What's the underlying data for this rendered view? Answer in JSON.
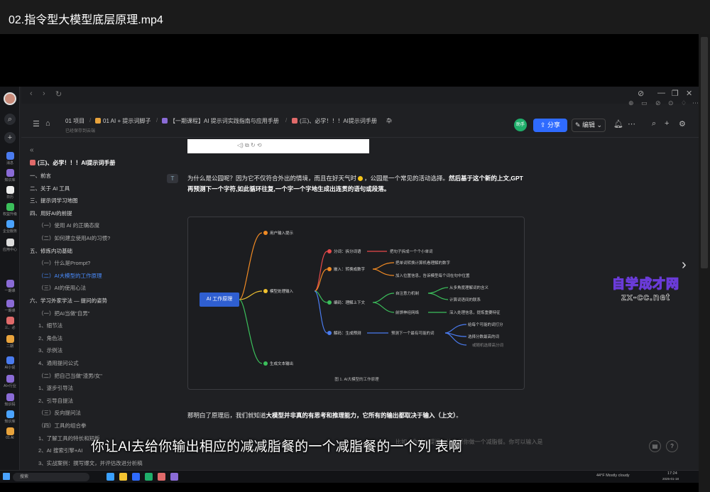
{
  "player": {
    "title": "02.指令型大模型底层原理.mp4",
    "next_icon": "chevron-right-icon"
  },
  "browser": {
    "nav": [
      "‹",
      "›",
      "↻"
    ],
    "window_controls": [
      "⊘",
      "—",
      "❐",
      "✕"
    ],
    "toolbar_icons": [
      "⊕",
      "▭",
      "⊘",
      "⊙",
      "♢",
      "⋯"
    ]
  },
  "doc_header": {
    "breadcrumbs": [
      {
        "label": "01 项目",
        "color": ""
      },
      {
        "label": "01 AI + 提示词脚子",
        "color": "#e8a33c"
      },
      {
        "label": "【一期课程】AI 提示词实践指南与应用手册",
        "color": "#8a6bd6"
      },
      {
        "label": "(三)、必学！！！AI提示词手册",
        "color": "#e06a6a"
      },
      {
        "label": "卆",
        "color": ""
      }
    ],
    "saved_note": "已经保存到云端",
    "assist_label": "助手",
    "share_label": "分享",
    "edit_label": "编辑",
    "icons": [
      "bell-icon",
      "more-icon",
      "search-icon",
      "add-icon",
      "settings-icon"
    ]
  },
  "outline": {
    "doc_title": "(三)、必学！！！AI提示词手册",
    "items": [
      {
        "label": "一、前言",
        "level": 1,
        "active": false
      },
      {
        "label": "二、关于 AI 工具",
        "level": 1,
        "active": false
      },
      {
        "label": "三、提示词学习地图",
        "level": 1,
        "active": false
      },
      {
        "label": "四、用好AI的前提",
        "level": 1,
        "active": false
      },
      {
        "label": "（一）使用 AI 的正确态度",
        "level": 2,
        "active": false
      },
      {
        "label": "（二）如何建立使用AI的习惯?",
        "level": 2,
        "active": false
      },
      {
        "label": "五、修炼内功基础",
        "level": 1,
        "active": false
      },
      {
        "label": "（一）什么是Prompt?",
        "level": 2,
        "active": false
      },
      {
        "label": "（二）AI大模型的工作原理",
        "level": 2,
        "active": true
      },
      {
        "label": "（三）AI的使用心法",
        "level": 2,
        "active": false
      },
      {
        "label": "六、学习外家学法 — 提问的姿势",
        "level": 1,
        "active": false
      },
      {
        "label": "（一）把AI当做\"自男\"",
        "level": 2,
        "active": false
      },
      {
        "label": "1、细节法",
        "level": 2,
        "active": false
      },
      {
        "label": "2、角色法",
        "level": 2,
        "active": false
      },
      {
        "label": "3、示例法",
        "level": 2,
        "active": false
      },
      {
        "label": "4、通用提问公式",
        "level": 2,
        "active": false
      },
      {
        "label": "（二）把自己当做\"渣男/女\"",
        "level": 2,
        "active": false
      },
      {
        "label": "1、逐步引导法",
        "level": 2,
        "active": false
      },
      {
        "label": "2、引导自提法",
        "level": 2,
        "active": false
      },
      {
        "label": "（三）反向提问法",
        "level": 2,
        "active": false
      },
      {
        "label": "（四）工具的组合拳",
        "level": 2,
        "active": false
      },
      {
        "label": "1、了解工具的特长和短板",
        "level": 2,
        "active": false
      },
      {
        "label": "2、AI 搜索引擎+AI",
        "level": 2,
        "active": false
      },
      {
        "label": "3、实战案例：撰写爆文，并评估改进分析稿",
        "level": 2,
        "active": false
      }
    ]
  },
  "content": {
    "para1_lead": "为什么是公园呢？因为它不仅符合外出的情境，而且在好天气时",
    "para1_mid": "，公园是一个常见的活动选择。",
    "para1_bold": "然后基于这个新的上文,GPT再预测下一个字符,如此循环往复,一个字一个字地生成出连贯的语句或段落。",
    "para2_lead": "那明白了原理后，我们就知道",
    "para2_bold": "大模型并非真的有思考和推理能力，它所有的输出都取决于输入（上文）",
    "para2_tail": "。",
    "faded_line": "比如，你给AI提问，让它帮你做一个减脂餐。你可以输入是",
    "bubble_mark": "T"
  },
  "diagram": {
    "root": "AI 工作原理",
    "branches": [
      {
        "label": "用户输入提示",
        "color": "#f08a24"
      },
      {
        "label": "模型处理输入",
        "color": "#f2c230"
      },
      {
        "label": "生成文本输出",
        "color": "#3bbf5b"
      }
    ],
    "sub_branches": [
      {
        "label": "分词：拆分词语",
        "color": "#e84a4a"
      },
      {
        "label": "嵌入：转换成数字",
        "color": "#f08a24"
      },
      {
        "label": "编码：理解上下文",
        "color": "#3bbf5b"
      },
      {
        "label": "解码：生成预测",
        "color": "#4a7bef"
      }
    ],
    "leaves": [
      "把句子拆成一个个小单词",
      "把单词转换计算机看理解的数字",
      "加入位置信息，告诉模型每个词在句中位置",
      "自注意力机制",
      "从多角度理解词的含义",
      "计算词语间的联系",
      "前馈神经网络",
      "深入处理信息，提炼重要特征",
      "预测下一个最有可能的词",
      "给每个可能的词打分",
      "选择分数最高的词",
      "或随机选择高分词"
    ],
    "caption": "图 1. AI大模型的工作原理"
  },
  "subtitle": "你让AI去给你输出相应的减减脂餐的一个减脂餐的一个列 表啊",
  "watermark": {
    "main": "自学成才网",
    "sub": "zx-cc.net"
  },
  "taskbar": {
    "search_placeholder": "搜索",
    "weather": "44°F  Mostly cloudy",
    "time": "17:24",
    "date": "2025-01-18"
  },
  "rail_apps": [
    {
      "label": "消息",
      "color": "#4a7bef"
    },
    {
      "label": "知识库",
      "color": "#8a6bd6"
    },
    {
      "label": "日历",
      "color": "#eee"
    },
    {
      "label": "权益升级",
      "color": "#3bbf5b"
    },
    {
      "label": "企业服务",
      "color": "#4aa3ff"
    },
    {
      "label": "应用中心",
      "color": "#ddd"
    },
    {
      "label": "一期课",
      "color": "#8a6bd6"
    },
    {
      "label": "一期课",
      "color": "#8a6bd6"
    },
    {
      "label": "三、必",
      "color": "#e06a6a"
    },
    {
      "label": "二期",
      "color": "#e8a33c"
    },
    {
      "label": "AI小说",
      "color": "#4a7bef"
    },
    {
      "label": "AI+行业",
      "color": "#8a6bd6"
    },
    {
      "label": "知识码",
      "color": "#8a6bd6"
    },
    {
      "label": "知识库",
      "color": "#4aa3ff"
    },
    {
      "label": "01 AI",
      "color": "#e8a33c"
    }
  ]
}
